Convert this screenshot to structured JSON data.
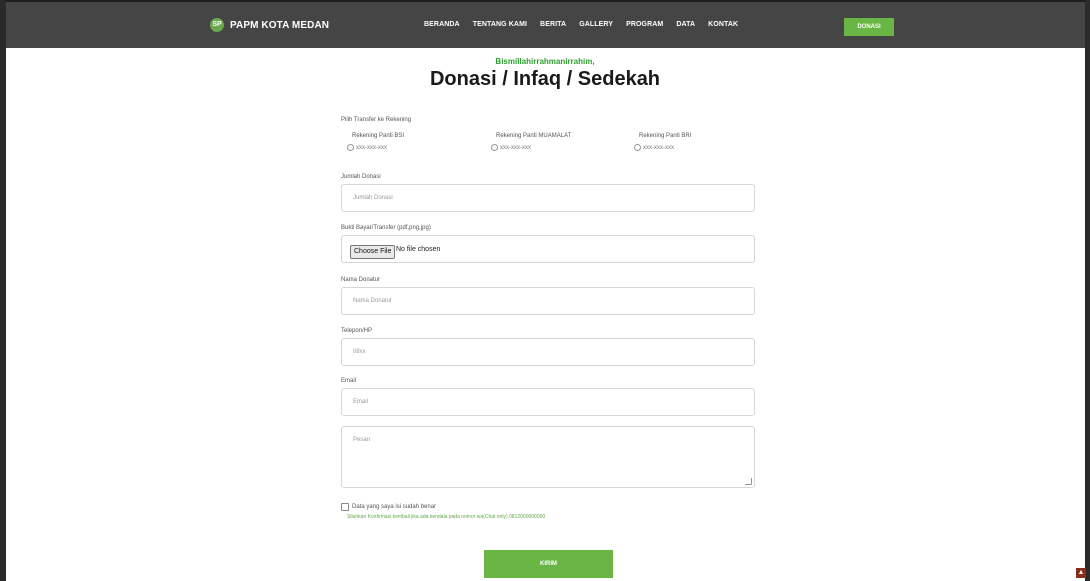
{
  "navbar": {
    "brand": "PAPM KOTA MEDAN",
    "logo_text": "SP",
    "links": [
      "BERANDA",
      "TENTANG KAMI",
      "BERITA",
      "GALLERY",
      "PROGRAM",
      "DATA",
      "KONTAK"
    ],
    "donasi_label": "DONASI"
  },
  "header": {
    "greeting": "Bismillahirrahmanirrahim,",
    "title": "Donasi / Infaq / Sedekah"
  },
  "form": {
    "transfer_label": "Pilih Transfer ke Rekening",
    "rekening": [
      {
        "title": "Rekening Panti BSI",
        "number": "xxx-xxx-xxx"
      },
      {
        "title": "Rekening Panti MUAMALAT",
        "number": "xxx-xxx-xxx"
      },
      {
        "title": "Rekening Panti BRI",
        "number": "xxx-xxx-xxx"
      }
    ],
    "jumlah_label": "Jumlah Donasi",
    "jumlah_placeholder": "Jumlah Donasi",
    "bukti_label": "Bukti Bayar/Transfer (pdf,png,jpg)",
    "file_button": "Choose File",
    "file_status": "No file chosen",
    "nama_label": "Nama Donatur",
    "nama_placeholder": "Nama Donatur",
    "telepon_label": "Telepon/HP",
    "telepon_placeholder": "08xx",
    "email_label": "Email",
    "email_placeholder": "Email",
    "pesan_placeholder": "Pesan",
    "confirm_label": "Data yang saya isi sudah benar",
    "note": "Silahkan Konfirmasi kembali jika ada kendala pada nomor wa(Chat only) 0812000000000",
    "submit_label": "KIRIM"
  },
  "colors": {
    "accent": "#6ab644",
    "navbar": "#454545",
    "greeting": "#2e9e2e"
  }
}
